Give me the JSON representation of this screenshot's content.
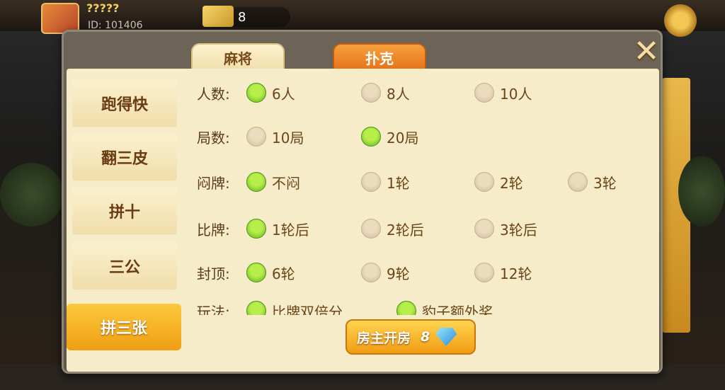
{
  "background": {
    "player_name": "?????",
    "player_id": "ID: 101406",
    "gem_count": "8"
  },
  "tabs": [
    {
      "label": "麻将"
    },
    {
      "label": "扑克"
    }
  ],
  "sidebar": [
    {
      "label": "跑得快"
    },
    {
      "label": "翻三皮"
    },
    {
      "label": "拼十"
    },
    {
      "label": "三公"
    },
    {
      "label": "拼三张"
    }
  ],
  "settings": {
    "players": {
      "label": "人数:",
      "options": [
        "6人",
        "8人",
        "10人"
      ],
      "selected": "6人"
    },
    "rounds": {
      "label": "局数:",
      "options": [
        "10局",
        "20局"
      ],
      "selected": "20局"
    },
    "stuffy": {
      "label": "闷牌:",
      "options": [
        "不闷",
        "1轮",
        "2轮",
        "3轮"
      ],
      "selected": "不闷"
    },
    "compare": {
      "label": "比牌:",
      "options": [
        "1轮后",
        "2轮后",
        "3轮后"
      ],
      "selected": "1轮后"
    },
    "cap": {
      "label": "封顶:",
      "options": [
        "6轮",
        "9轮",
        "12轮"
      ],
      "selected": "6轮"
    },
    "play": {
      "label": "玩法:",
      "options": [
        "比牌双倍分",
        "豹子额外奖"
      ],
      "selected": [
        "比牌双倍分",
        "豹子额外奖"
      ]
    }
  },
  "create_button": {
    "label": "房主开房",
    "cost": "8"
  },
  "close_label": "✕"
}
